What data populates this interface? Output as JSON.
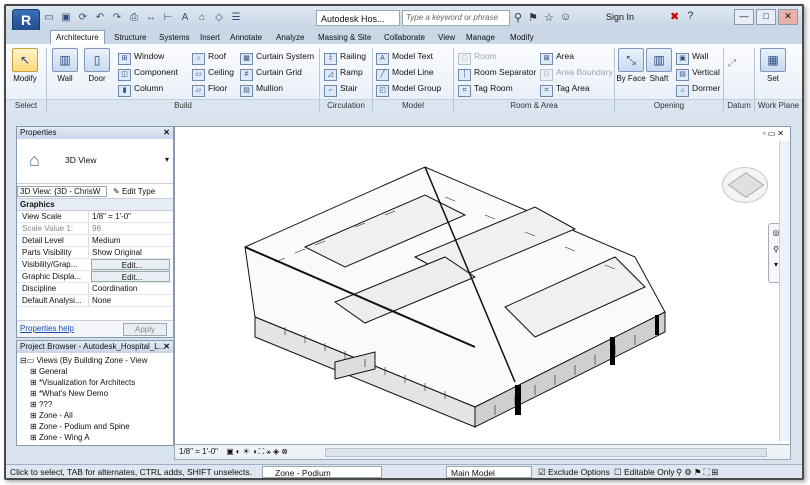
{
  "window": {
    "app_button": "R",
    "document_title": "Autodesk Hos...",
    "search_placeholder": "Type a keyword or phrase",
    "sign_in": "Sign In",
    "win_min": "—",
    "win_max": "□",
    "win_close": "✕"
  },
  "tabs": [
    "Architecture",
    "Structure",
    "Systems",
    "Insert",
    "Annotate",
    "Analyze",
    "Massing & Site",
    "Collaborate",
    "View",
    "Manage",
    "Modify"
  ],
  "active_tab": "Architecture",
  "ribbon": {
    "modify": "Modify",
    "wall": "Wall",
    "door": "Door",
    "build_col1": [
      "Window",
      "Component",
      "Column"
    ],
    "build_col2": [
      "Roof",
      "Ceiling",
      "Floor"
    ],
    "build_col3": [
      "Curtain System",
      "Curtain Grid",
      "Mullion"
    ],
    "circulation": [
      "Railing",
      "Ramp",
      "Stair"
    ],
    "model": [
      "Model Text",
      "Model Line",
      "Model Group"
    ],
    "room_col1": [
      "Room",
      "Room Separator",
      "Tag Room"
    ],
    "room_col2": [
      "Area",
      "Area Boundary",
      "Tag Area"
    ],
    "opening_big": [
      "By Face",
      "Shaft"
    ],
    "opening_small": [
      "Wall",
      "Vertical",
      "Dormer"
    ],
    "wp": "Set",
    "groups": {
      "select": "Select",
      "build": "Build",
      "circulation": "Circulation",
      "model": "Model",
      "room": "Room & Area",
      "opening": "Opening",
      "datum": "Datum",
      "work_plane": "Work Plane"
    }
  },
  "properties": {
    "title": "Properties",
    "type_name": "3D View",
    "instance": "3D View: {3D - ChrisW",
    "edit_type": "Edit Type",
    "section": "Graphics",
    "rows": [
      {
        "k": "View Scale",
        "v": "1/8\" = 1'-0\""
      },
      {
        "k": "Scale Value    1:",
        "v": "96"
      },
      {
        "k": "Detail Level",
        "v": "Medium"
      },
      {
        "k": "Parts Visibility",
        "v": "Show Original"
      },
      {
        "k": "Visibility/Grap...",
        "v": "Edit..."
      },
      {
        "k": "Graphic Displa...",
        "v": "Edit..."
      },
      {
        "k": "Discipline",
        "v": "Coordination"
      },
      {
        "k": "Default Analysi...",
        "v": "None"
      }
    ],
    "help_link": "Properties help",
    "apply": "Apply"
  },
  "browser": {
    "title": "Project Browser - Autodesk_Hospital_L...",
    "root": "Views (By Building Zone - View",
    "items": [
      "General",
      "*Visualization for Architects",
      "*What's New Demo",
      "???",
      "Zone - All",
      "Zone - Podium and Spine",
      "Zone - Wing A"
    ]
  },
  "view_control": {
    "scale": "1/8\" = 1'-0\""
  },
  "status": {
    "hint": "Click to select, TAB for alternates, CTRL adds, SHIFT unselects.",
    "workset": "Zone - Podium",
    "design_option": "Main Model",
    "exclude_options": "Exclude Options",
    "editable_only": "Editable Only"
  },
  "colors": {
    "accent": "#1e4a8a",
    "ribbon_bg": "#e7eef7"
  }
}
